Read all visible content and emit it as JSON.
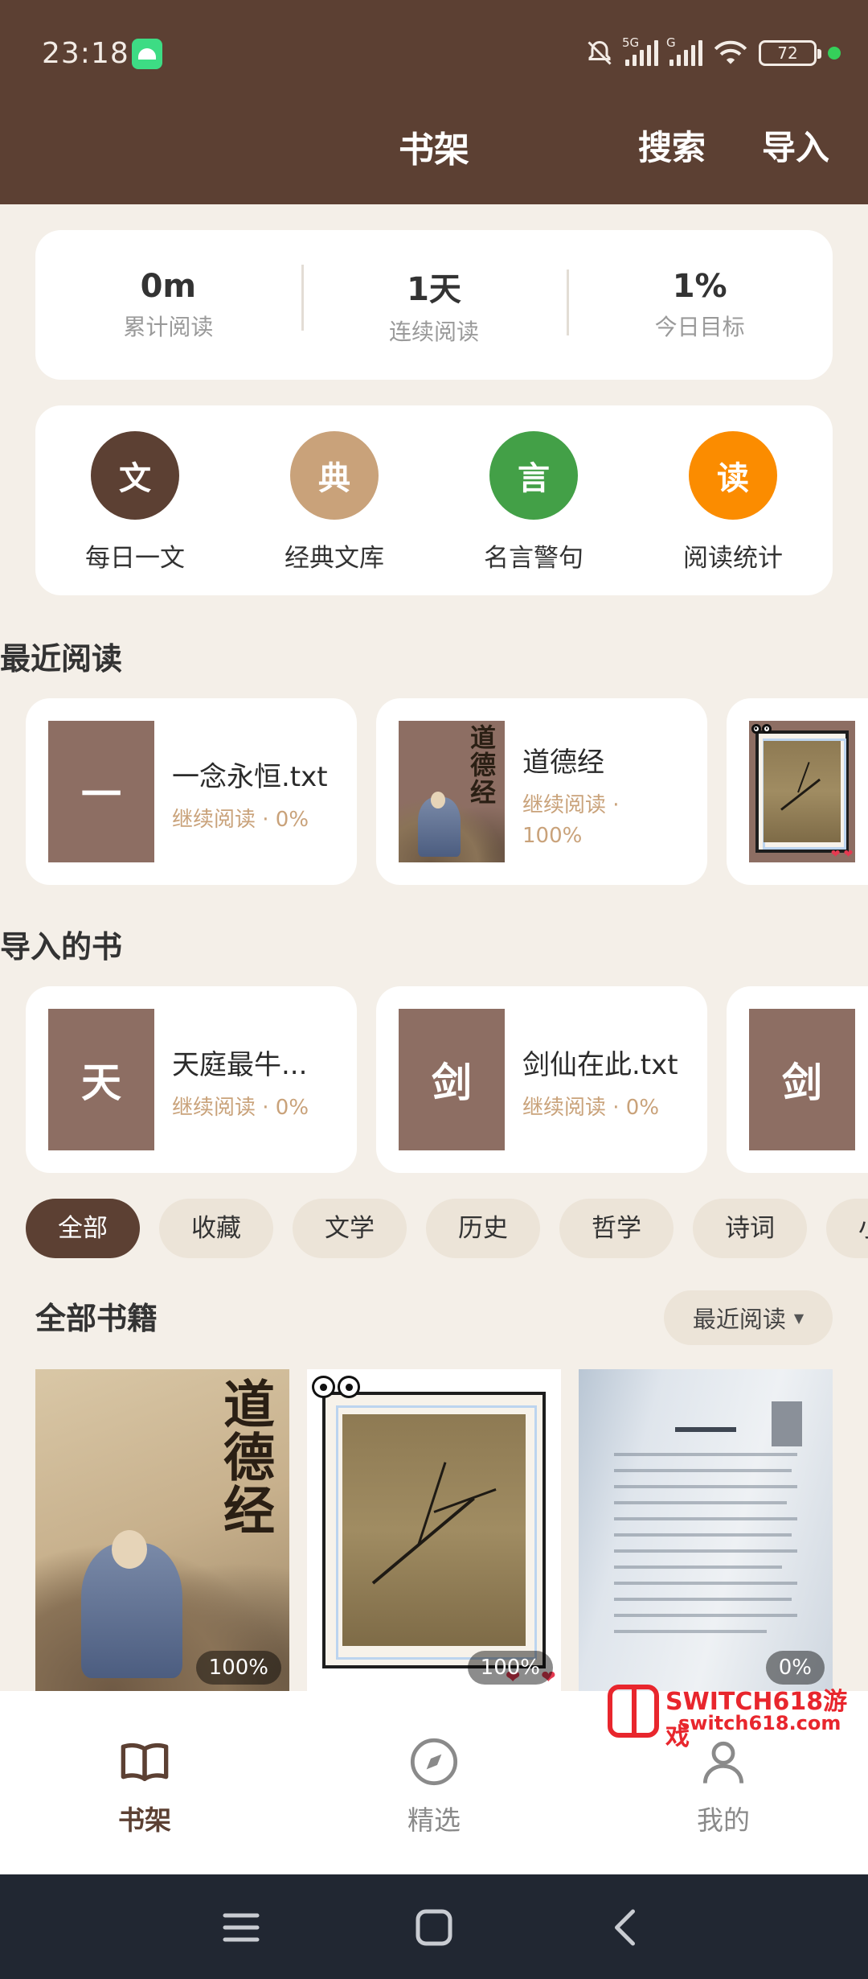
{
  "status_bar": {
    "time": "23:18",
    "net1": "5G",
    "net2": "G",
    "battery": "72"
  },
  "header": {
    "title": "书架",
    "search_label": "搜索",
    "import_label": "导入"
  },
  "stats": [
    {
      "value": "0m",
      "label": "累计阅读"
    },
    {
      "value": "1天",
      "label": "连续阅读"
    },
    {
      "value": "1%",
      "label": "今日目标"
    }
  ],
  "quick_actions": [
    {
      "glyph": "文",
      "label": "每日一文",
      "color": "#5c4033"
    },
    {
      "glyph": "典",
      "label": "经典文库",
      "color": "#c9a27a"
    },
    {
      "glyph": "言",
      "label": "名言警句",
      "color": "#43a047"
    },
    {
      "glyph": "读",
      "label": "阅读统计",
      "color": "#fb8c00"
    }
  ],
  "recent": {
    "title": "最近阅读",
    "items": [
      {
        "thumb": "一",
        "name": "一念永恒.txt",
        "progress": "继续阅读 · 0%"
      },
      {
        "cover_title": "道德经",
        "name": "道德经",
        "progress": "继续阅读 · 100%"
      }
    ]
  },
  "imported": {
    "title": "导入的书",
    "items": [
      {
        "thumb": "天",
        "name": "天庭最牛...",
        "progress": "继续阅读 · 0%"
      },
      {
        "thumb": "剑",
        "name": "剑仙在此.txt",
        "progress": "继续阅读 · 0%"
      },
      {
        "thumb": "剑"
      }
    ]
  },
  "filters": [
    "全部",
    "收藏",
    "文学",
    "历史",
    "哲学",
    "诗词",
    "小说"
  ],
  "all_books": {
    "title": "全部书籍",
    "sort_label": "最近阅读",
    "items": [
      {
        "cover_title": "道德经",
        "percent": "100%"
      },
      {
        "percent": "100%"
      },
      {
        "percent": "0%"
      }
    ]
  },
  "bottom_nav": [
    "书架",
    "精选",
    "我的"
  ],
  "watermark": {
    "line1": "SWITCH618游戏",
    "line2": "switch618.com"
  }
}
